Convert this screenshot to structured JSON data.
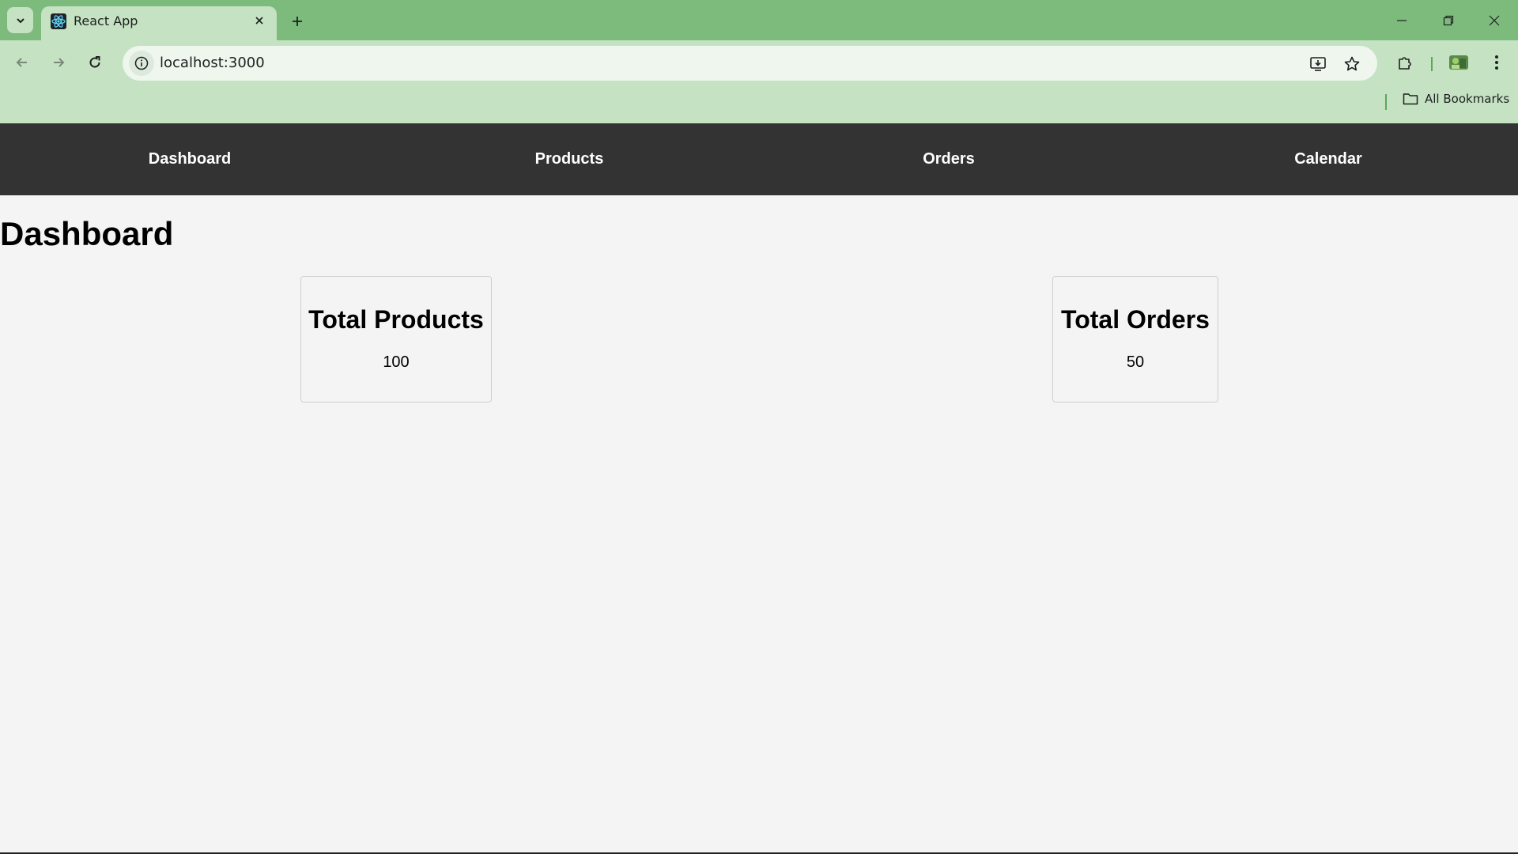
{
  "browser": {
    "tab_title": "React App",
    "url": "localhost:3000",
    "bookmarks_label": "All Bookmarks",
    "accent_color": "#7cbb7c",
    "toolbar_color": "#c5e2c3"
  },
  "app": {
    "nav": [
      {
        "label": "Dashboard"
      },
      {
        "label": "Products"
      },
      {
        "label": "Orders"
      },
      {
        "label": "Calendar"
      }
    ],
    "page_title": "Dashboard",
    "cards": [
      {
        "title": "Total Products",
        "value": "100"
      },
      {
        "title": "Total Orders",
        "value": "50"
      }
    ],
    "nav_color": "#333333"
  }
}
